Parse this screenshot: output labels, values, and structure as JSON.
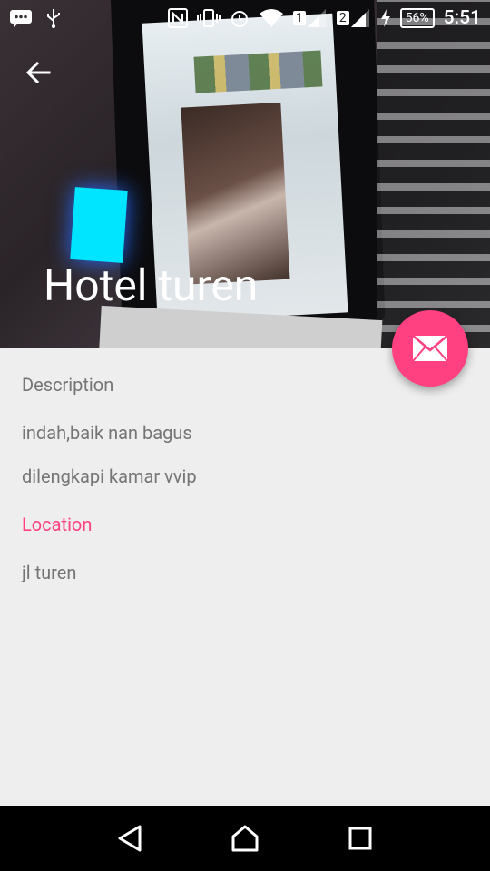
{
  "status_bar": {
    "sim1": "1",
    "sim2": "2",
    "battery": "56%",
    "time": "5:51"
  },
  "header": {
    "title": "Hotel turen"
  },
  "details": {
    "description_label": "Description",
    "description_line1": "indah,baik nan bagus",
    "description_line2": "dilengkapi kamar vvip",
    "location_label": "Location",
    "location_value": "jl turen"
  },
  "colors": {
    "accent": "#ff4081",
    "text_secondary": "#757575",
    "background": "#eeeeee"
  },
  "icons": {
    "back": "arrow-left-icon",
    "fab": "mail-icon",
    "nav_back": "triangle-back-icon",
    "nav_home": "home-icon",
    "nav_recents": "square-recents-icon"
  }
}
